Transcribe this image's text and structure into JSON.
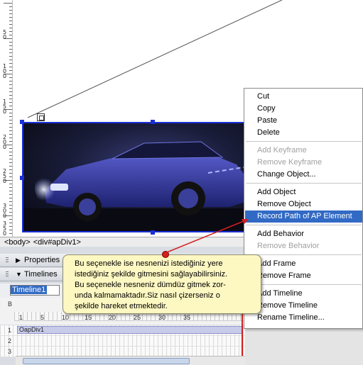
{
  "ruler": {
    "labels": [
      "50",
      "100",
      "150",
      "200",
      "250",
      "300",
      "350"
    ]
  },
  "status_bar": {
    "tag_body": "<body>",
    "tag_div": "<div#apDiv1>"
  },
  "panels": {
    "properties": "Properties",
    "timelines": "Timelines",
    "timeline_selected": "Timeline1",
    "b_channel": "B",
    "frame_numbers": [
      "1",
      "5",
      "10",
      "15",
      "20",
      "25",
      "30",
      "35"
    ],
    "layers": [
      "1",
      "2",
      "3"
    ],
    "object_label": "OapDiv1"
  },
  "tooltip": {
    "lines": [
      "Bu seçenekle ise nesnenizi istediğiniz yere",
      "istediğiniz şekilde gitmesini sağlayabilirsiniz.",
      "Bu seçenekle nesneniz dümdüz gitmek zor-",
      "unda kalmamaktadır.Siz nasıl çizerseniz o",
      "şekilde hareket etmektedir."
    ]
  },
  "context_menu": {
    "groups": [
      [
        {
          "label": "Cut",
          "disabled": false
        },
        {
          "label": "Copy",
          "disabled": false
        },
        {
          "label": "Paste",
          "disabled": false
        },
        {
          "label": "Delete",
          "disabled": false
        }
      ],
      [
        {
          "label": "Add Keyframe",
          "disabled": true
        },
        {
          "label": "Remove Keyframe",
          "disabled": true
        },
        {
          "label": "Change Object...",
          "disabled": false
        }
      ],
      [
        {
          "label": "Add Object",
          "disabled": false
        },
        {
          "label": "Remove Object",
          "disabled": false
        },
        {
          "label": "Record Path of AP Element",
          "disabled": false,
          "highlighted": true
        }
      ],
      [
        {
          "label": "Add Behavior",
          "disabled": false
        },
        {
          "label": "Remove Behavior",
          "disabled": true
        }
      ],
      [
        {
          "label": "Add Frame",
          "disabled": false
        },
        {
          "label": "Remove Frame",
          "disabled": false
        }
      ],
      [
        {
          "label": "Add Timeline",
          "disabled": false
        },
        {
          "label": "Remove Timeline",
          "disabled": false
        },
        {
          "label": "Rename Timeline...",
          "disabled": false
        }
      ]
    ]
  },
  "colors": {
    "selection_blue": "#1b2fd6",
    "menu_highlight": "#316ac5",
    "tooltip_bg": "#fdf7c2",
    "annotation_red": "#d32020"
  }
}
